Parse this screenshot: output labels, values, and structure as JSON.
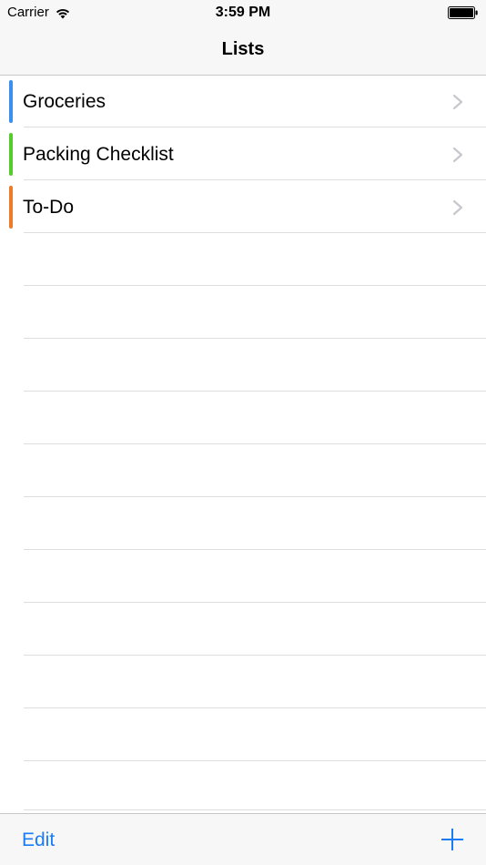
{
  "status_bar": {
    "carrier": "Carrier",
    "time": "3:59 PM",
    "wifi_icon": "wifi-icon",
    "battery_icon": "battery-icon"
  },
  "nav_bar": {
    "title": "Lists"
  },
  "lists": [
    {
      "label": "Groceries",
      "color": "#3b8ff0"
    },
    {
      "label": "Packing Checklist",
      "color": "#55cc2e"
    },
    {
      "label": "To-Do",
      "color": "#ee7a2c"
    }
  ],
  "toolbar": {
    "edit_label": "Edit",
    "add_icon": "plus-icon",
    "accent_color": "#1a7cf5"
  }
}
